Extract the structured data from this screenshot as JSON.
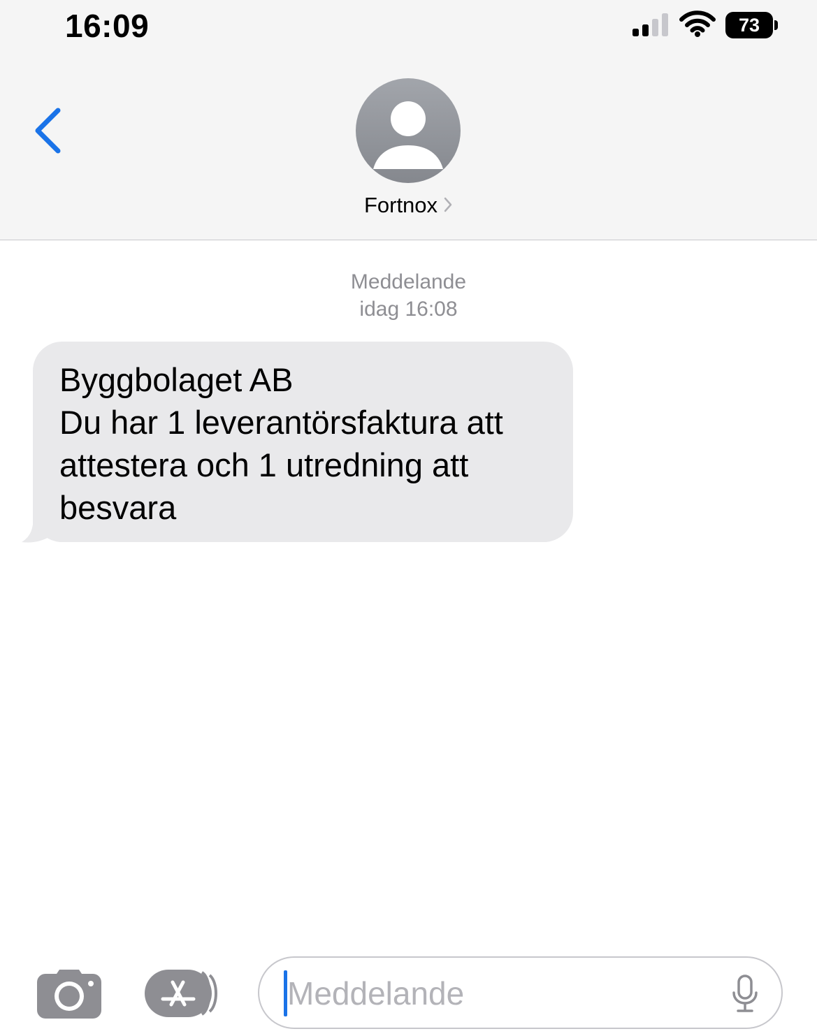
{
  "status_bar": {
    "time": "16:09",
    "battery_level": "73",
    "signal_bars_active": 2,
    "signal_bars_total": 4,
    "signal-icon": "cellular-signal-icon",
    "wifi-icon": "wifi-icon",
    "battery-icon": "battery-icon"
  },
  "header": {
    "back_icon": "chevron-left-icon",
    "avatar_icon": "person-silhouette-icon",
    "contact_name": "Fortnox",
    "contact_chevron_icon": "chevron-right-icon"
  },
  "conversation": {
    "meta_label": "Meddelande",
    "meta_time": "idag 16:08",
    "messages": [
      {
        "direction": "incoming",
        "text": "Byggbolaget AB\nDu har 1 leverantörsfaktura att attestera och 1 utredning att besvara"
      }
    ]
  },
  "input_bar": {
    "camera_icon": "camera-icon",
    "apps_icon": "app-store-icon",
    "placeholder": "Meddelande",
    "mic_icon": "microphone-icon"
  },
  "colors": {
    "header_bg": "#f5f5f5",
    "accent_blue": "#1a73e8",
    "incoming_bubble": "#e9e9eb",
    "meta_text": "#8e8e93",
    "icon_gray": "#8e8e93"
  }
}
